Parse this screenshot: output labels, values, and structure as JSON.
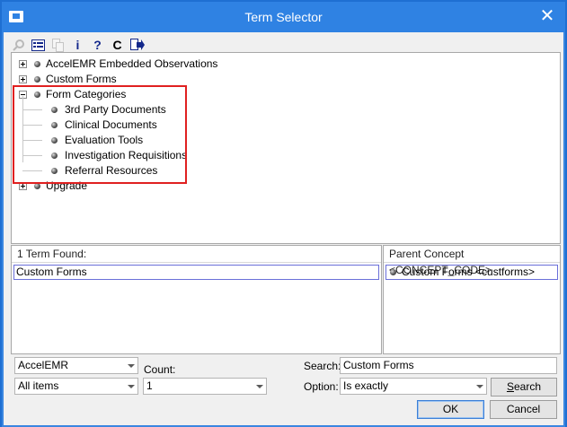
{
  "window": {
    "title": "Term Selector",
    "close_glyph": "✕"
  },
  "toolbar": {
    "icons": [
      "search-icon",
      "list-view-icon",
      "copy-icon",
      "info-icon",
      "help-icon",
      "refresh-icon",
      "export-icon"
    ],
    "info_glyph": "i",
    "help_glyph": "?",
    "refresh_glyph": "C"
  },
  "tree": {
    "items": [
      {
        "label": "AccelEMR Embedded Observations",
        "expanded": false
      },
      {
        "label": "Custom Forms",
        "expanded": false
      },
      {
        "label": "Form Categories",
        "expanded": true,
        "children": [
          "3rd Party Documents",
          "Clinical Documents",
          "Evaluation Tools",
          "Investigation Requisitions",
          "Referral Resources"
        ]
      },
      {
        "label": "Upgrade",
        "expanded": false
      }
    ],
    "highlight_color": "#e02020"
  },
  "results": {
    "header": "1 Term Found:",
    "items": [
      "Custom Forms"
    ]
  },
  "parent": {
    "header": "Parent Concept <CONCEPT_CODE>",
    "items": [
      "Custom Forms <custforms>"
    ]
  },
  "filters": {
    "source_value": "AccelEMR",
    "scope_value": "All items",
    "count_label": "Count:",
    "count_value": "1",
    "search_label": "Search:",
    "search_value": "Custom Forms",
    "option_label": "Option:",
    "option_value": "Is exactly",
    "search_button": "Search"
  },
  "buttons": {
    "ok": "OK",
    "cancel": "Cancel"
  }
}
